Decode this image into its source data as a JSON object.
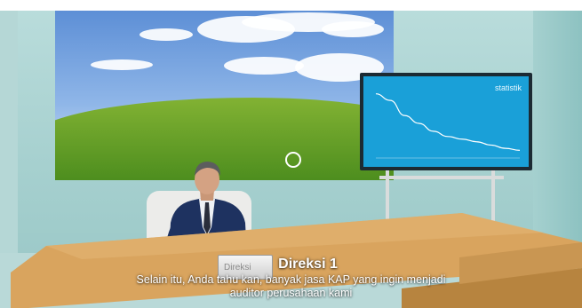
{
  "screen_chart": {
    "title": "statistik",
    "line_color": "#ffffff",
    "background_color": "#1aa0d8",
    "chart_data": {
      "type": "line",
      "title": "statistik",
      "x": [
        0,
        1,
        2,
        3,
        4,
        5,
        6,
        7,
        8,
        9,
        10
      ],
      "y": [
        0.95,
        0.85,
        0.62,
        0.5,
        0.38,
        0.3,
        0.26,
        0.22,
        0.17,
        0.12,
        0.09
      ],
      "ylim": [
        0,
        1
      ],
      "grid": false
    }
  },
  "nameplate": {
    "text": "Direksi"
  },
  "dialogue": {
    "speaker": "Direksi 1",
    "line1": "Selain itu, Anda tahu kan, banyak jasa KAP yang ingin menjadi",
    "line2": "auditor perusahaan kami"
  },
  "reticle": {
    "icon": "circle-reticle-icon",
    "color": "#ffffff"
  },
  "colors": {
    "wall": "#a6d0cf",
    "desk": "#d9a45e",
    "suit": "#1e3260",
    "chart_screen": "#1aa0d8"
  }
}
